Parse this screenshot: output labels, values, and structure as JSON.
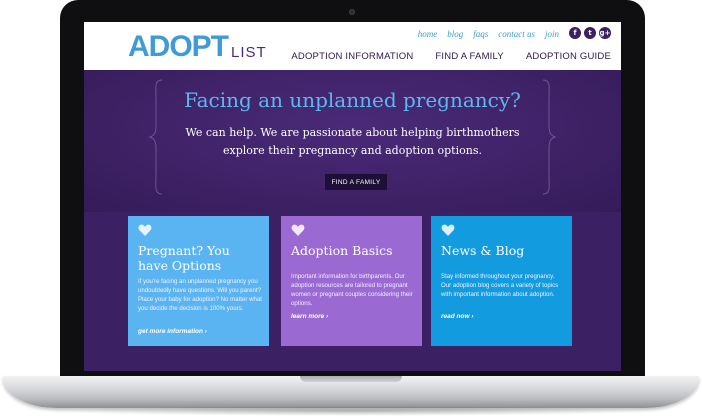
{
  "brand": {
    "logo_main": "ADOPT",
    "logo_sub": "LIST"
  },
  "top_links": [
    "home",
    "blog",
    "faqs",
    "contact us",
    "join"
  ],
  "social_icons": [
    {
      "name": "facebook-icon",
      "glyph": "f"
    },
    {
      "name": "twitter-icon",
      "glyph": "t"
    },
    {
      "name": "google-plus-icon",
      "glyph": "g+"
    }
  ],
  "main_nav": [
    "ADOPTION INFORMATION",
    "FIND A FAMILY",
    "ADOPTION GUIDE"
  ],
  "hero": {
    "title": "Facing an unplanned pregnancy?",
    "text": "We can help. We are passionate about helping birthmothers explore their pregnancy and adoption options.",
    "button": "FIND A FAMILY"
  },
  "cards": [
    {
      "title": "Pregnant? You have Options",
      "text": "If you're facing an unplanned pregnancy you undoubtedly have questions. Will you parent? Place your baby for adoption? No matter what you decide the decision is 100% yours.",
      "link": "get more information ›",
      "color": "#5ab4f2"
    },
    {
      "title": "Adoption Basics",
      "text": "Important information for birthparents. Our adoption resources are tailored to pregnant women or pregnant couples considering their options.",
      "link": "learn more ›",
      "color": "#9a69d2"
    },
    {
      "title": "News & Blog",
      "text": "Stay informed throughout your pregnancy. Our adoption blog covers a variety of topics with important information about adoption.",
      "link": "read now ›",
      "color": "#139be0"
    }
  ],
  "colors": {
    "brand_blue": "#3f9ad6",
    "brand_purple": "#3b2063",
    "hero_title": "#5cb8ee"
  }
}
